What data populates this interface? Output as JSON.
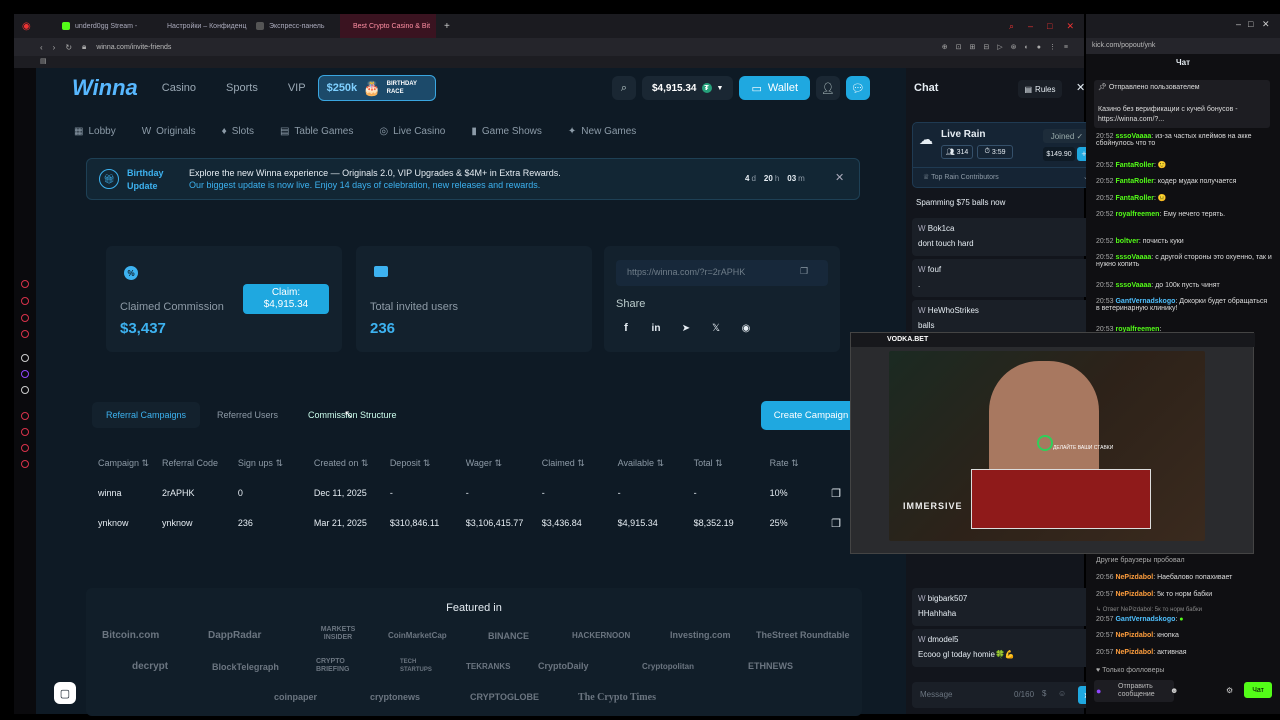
{
  "browser": {
    "tabs": [
      "underd0gg Stream - ",
      "Настройки – Конфиденц",
      "Экспресс-панель",
      "Best Crypto Casino & Bit"
    ],
    "url": "winna.com/invite-friends"
  },
  "site": {
    "logo": "Winna",
    "nav": [
      "Casino",
      "Sports",
      "VIP"
    ],
    "race_amount": "$250k",
    "race_label": "BIRTHDAY RACE",
    "balance": "$4,915.34",
    "wallet_label": "Wallet",
    "subnav": [
      "Lobby",
      "Originals",
      "Slots",
      "Table Games",
      "Live Casino",
      "Game Shows",
      "New Games"
    ],
    "banner": {
      "title": "Birthday Update",
      "line1": "Explore the new Winna experience — Originals 2.0, VIP Upgrades & $4M+ in Extra Rewards.",
      "line2": "Our biggest update is now live. Enjoy 14 days of celebration, new releases and rewards.",
      "days": "4",
      "d": "d",
      "hours": "20",
      "h": "h",
      "minutes": "03",
      "m": "m"
    },
    "commission": {
      "label": "Claimed Commission",
      "value": "$3,437",
      "claim_label": "Claim:",
      "claim_amount": "$4,915.34"
    },
    "invited": {
      "label": "Total invited users",
      "value": "236"
    },
    "share": {
      "link": "https://winna.com/?r=2rAPHK",
      "label": "Share"
    },
    "tabs": [
      "Referral Campaigns",
      "Referred Users",
      "Commission Structure"
    ],
    "create_button": "Create Campaign",
    "table": {
      "headers": [
        "Campaign",
        "Referral Code",
        "Sign ups",
        "Created on",
        "Deposit",
        "Wager",
        "Claimed",
        "Available",
        "Total",
        "Rate"
      ],
      "rows": [
        [
          "winna",
          "2rAPHK",
          "0",
          "Dec 11, 2025",
          "-",
          "-",
          "-",
          "-",
          "-",
          "10%"
        ],
        [
          "ynknow",
          "ynknow",
          "236",
          "Mar 21, 2025",
          "$310,846.11",
          "$3,106,415.77",
          "$3,436.84",
          "$4,915.34",
          "$8,352.19",
          "25%"
        ]
      ]
    },
    "featured": {
      "title": "Featured in",
      "logos": [
        "Bitcoin.com",
        "DappRadar",
        "MARKETS INSIDER",
        "CoinMarketCap",
        "BINANCE",
        "HACKERNOON",
        "Investing.com",
        "TheStreet Roundtable",
        "decrypt",
        "BlockTelegraph",
        "CRYPTO BRIEFING",
        "TECH STARTUPS",
        "TEKRANKS",
        "CryptoDaily",
        "Cryptopolitan",
        "ETHNEWS",
        "coinpaper",
        "cryptonews",
        "CRYPTOGLOBE",
        "The Crypto Times"
      ]
    }
  },
  "chat": {
    "title": "Chat",
    "rules": "Rules",
    "rain": {
      "title": "Live Rain",
      "players": "314",
      "timer": "3:59",
      "status": "Joined",
      "amount": "$149.90",
      "contributors": "Top Rain Contributors"
    },
    "messages": [
      {
        "user": "",
        "text": "Spamming $75 balls now"
      },
      {
        "user": "Bok1ca",
        "text": "dont touch hard"
      },
      {
        "user": "fouf",
        "text": "."
      },
      {
        "user": "HeWhoStrikes",
        "text": "balls"
      },
      {
        "user": "bigbark507",
        "text": "HHahhaha"
      },
      {
        "user": "dmodel5",
        "text": "Ecooo gl today homie🍀💪"
      }
    ],
    "input_placeholder": "Message",
    "char_count": "0/160"
  },
  "kick": {
    "url": "kick.com/popout/ynk",
    "title": "Чат",
    "pinned_header": "Отправлено пользователем",
    "pinned_text": "Казино без верификации с кучей бонусов - https://winna.com/?...",
    "messages": [
      {
        "time": "20:52",
        "name": "sssoVaaaa",
        "text": "из-за частых клеймов на акке сбойнулось что то"
      },
      {
        "time": "20:52",
        "name": "FantaRoller",
        "text": ""
      },
      {
        "time": "20:52",
        "name": "FantaRoller",
        "text": "кодер мудак получается"
      },
      {
        "time": "20:52",
        "name": "FantaRoller",
        "text": ""
      },
      {
        "time": "20:52",
        "name": "royalfreemen",
        "text": "Ему нечего терять."
      },
      {
        "time": "20:52",
        "name": "boltver",
        "text": "почисть куки"
      },
      {
        "time": "20:52",
        "name": "sssoVaaaa",
        "text": "с другой стороны это охуенно, так и нужно копить"
      },
      {
        "time": "20:52",
        "name": "sssoVaaaa",
        "text": "до 100к пусть чинят"
      },
      {
        "time": "20:53",
        "name": "GantVernadskogo",
        "text": "Докорки будет обращаться в ветеринарную клинику!"
      },
      {
        "time": "20:53",
        "name": "royalfreemen",
        "text": ""
      },
      {
        "time": "",
        "name": "",
        "text": "Другие браузеры пробовал"
      },
      {
        "time": "20:56",
        "name": "NePizdabol",
        "text": "Наебалово попахивает"
      },
      {
        "time": "20:57",
        "name": "NePizdabol",
        "text": "5к то норм бабки"
      },
      {
        "time": "",
        "name": "",
        "text": "Ответ NePizdabol: 5к то норм бабки"
      },
      {
        "time": "20:57",
        "name": "GantVernadskogo",
        "text": ""
      },
      {
        "time": "20:57",
        "name": "NePizdabol",
        "text": "кнопка"
      },
      {
        "time": "20:57",
        "name": "NePizdabol",
        "text": "активная"
      }
    ],
    "followers_only": "Только фолловеры",
    "input_placeholder": "Отправить сообщение",
    "chat_button": "Чат"
  },
  "overlay": {
    "brand": "VODKA.BET",
    "game": "IMMERSIVE",
    "place_bets": "ДЕЛАЙТЕ ВАШИ СТАВКИ"
  },
  "colors": {
    "accent": "#1fa8e0",
    "kick_green": "#53fc18",
    "bg": "#0e1a25"
  }
}
